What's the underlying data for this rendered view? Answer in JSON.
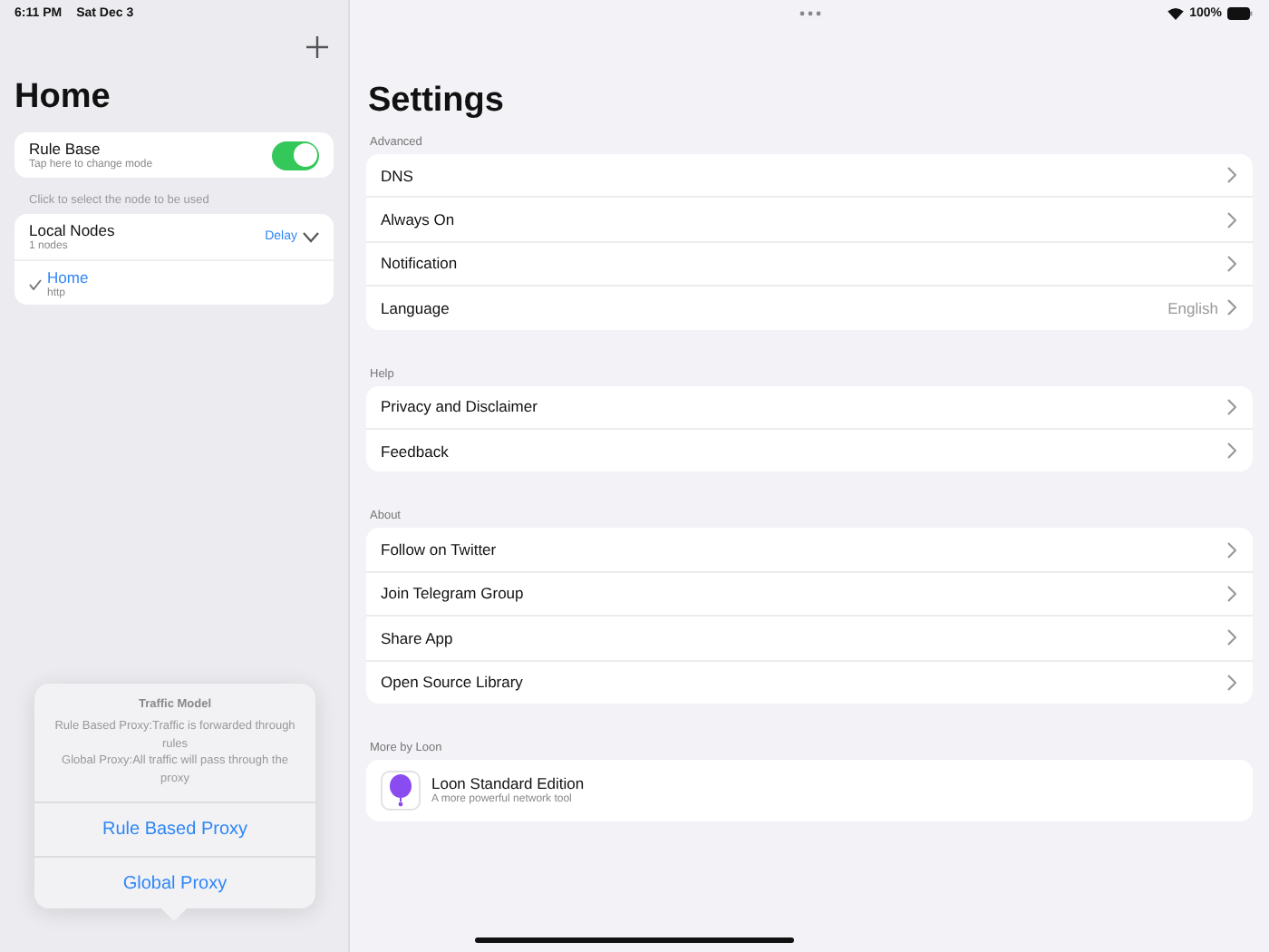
{
  "status_bar": {
    "time": "6:11 PM",
    "date": "Sat Dec 3",
    "battery": "100%"
  },
  "sidebar": {
    "title": "Home",
    "mode": {
      "title": "Rule Base",
      "subtitle": "Tap here to change mode",
      "on": true
    },
    "hint": "Click to select the node to be used",
    "group": {
      "title": "Local Nodes",
      "subtitle": "1 nodes",
      "sort": "Delay",
      "nodes": [
        {
          "name": "Home",
          "type": "http",
          "selected": true
        }
      ]
    }
  },
  "settings": {
    "title": "Settings",
    "sections": [
      {
        "header": "Advanced",
        "rows": [
          {
            "label": "DNS"
          },
          {
            "label": "Always On"
          },
          {
            "label": "Notification"
          },
          {
            "label": "Language",
            "value": "English"
          }
        ]
      },
      {
        "header": "Help",
        "rows": [
          {
            "label": "Privacy and Disclaimer"
          },
          {
            "label": "Feedback"
          }
        ]
      },
      {
        "header": "About",
        "rows": [
          {
            "label": "Follow on Twitter"
          },
          {
            "label": "Join Telegram Group"
          },
          {
            "label": "Share App"
          },
          {
            "label": "Open Source Library"
          }
        ]
      }
    ],
    "more": {
      "header": "More by Loon",
      "app": {
        "name": "Loon Standard Edition",
        "subtitle": "A more powerful network tool"
      }
    }
  },
  "popover": {
    "title": "Traffic Model",
    "message": [
      "Rule Based Proxy:Traffic is forwarded through rules",
      "Global Proxy:All traffic will pass through the proxy"
    ],
    "actions": [
      "Rule Based Proxy",
      "Global Proxy"
    ]
  }
}
